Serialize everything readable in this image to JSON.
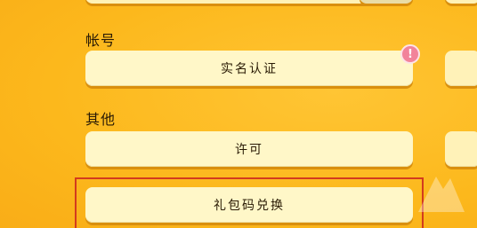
{
  "sections": {
    "account": {
      "label": "帐号",
      "verify_button": "实名认证",
      "badge_icon": "exclamation-icon"
    },
    "other": {
      "label": "其他",
      "license_button": "许可",
      "redeem_button": "礼包码兑换"
    }
  },
  "colors": {
    "background": "#fcb81c",
    "button_fill": "#fff7c8",
    "badge": "#f2839a",
    "highlight_border": "#d33b1e"
  }
}
